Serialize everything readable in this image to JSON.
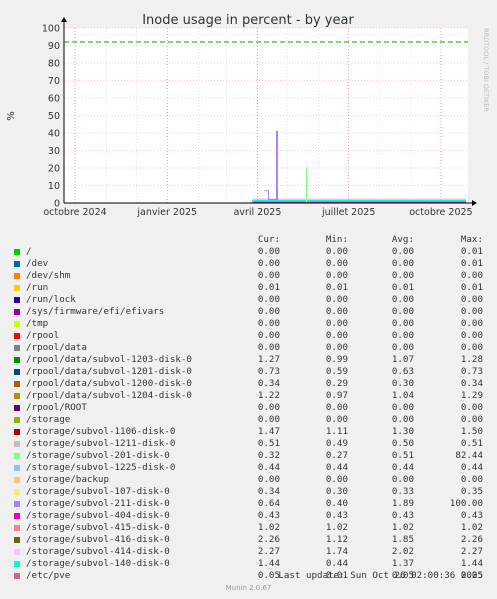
{
  "chart_data": {
    "type": "line",
    "title": "Inode usage in percent - by year",
    "ylabel": "%",
    "side_label": "RRDTOOL / TOBI OETIKER",
    "ylim": [
      0,
      100
    ],
    "yticks": [
      0,
      10,
      20,
      30,
      40,
      50,
      60,
      70,
      80,
      90,
      100
    ],
    "x_range": [
      "2024-09-20",
      "2025-10-28"
    ],
    "xticks": [
      {
        "date": "2024-10-01",
        "label": "octobre 2024"
      },
      {
        "date": "2025-01-01",
        "label": "janvier 2025"
      },
      {
        "date": "2025-04-01",
        "label": "avril 2025"
      },
      {
        "date": "2025-07-01",
        "label": "juillet 2025"
      },
      {
        "date": "2025-10-01",
        "label": "octobre 2025"
      }
    ],
    "warning_line": 92,
    "grid": true,
    "legend_headers": [
      "Cur:",
      "Min:",
      "Avg:",
      "Max:"
    ],
    "series": [
      {
        "name": "/",
        "color": "#00cc00",
        "cur": "0.00",
        "min": "0.00",
        "avg": "0.00",
        "max": "0.01"
      },
      {
        "name": "/dev",
        "color": "#0066b3",
        "cur": "0.00",
        "min": "0.00",
        "avg": "0.00",
        "max": "0.01"
      },
      {
        "name": "/dev/shm",
        "color": "#ff8000",
        "cur": "0.00",
        "min": "0.00",
        "avg": "0.00",
        "max": "0.00"
      },
      {
        "name": "/run",
        "color": "#ffcc00",
        "cur": "0.01",
        "min": "0.01",
        "avg": "0.01",
        "max": "0.01"
      },
      {
        "name": "/run/lock",
        "color": "#330099",
        "cur": "0.00",
        "min": "0.00",
        "avg": "0.00",
        "max": "0.00"
      },
      {
        "name": "/sys/firmware/efi/efivars",
        "color": "#990099",
        "cur": "0.00",
        "min": "0.00",
        "avg": "0.00",
        "max": "0.00"
      },
      {
        "name": "/tmp",
        "color": "#ccff00",
        "cur": "0.00",
        "min": "0.00",
        "avg": "0.00",
        "max": "0.00"
      },
      {
        "name": "/rpool",
        "color": "#ff0000",
        "cur": "0.00",
        "min": "0.00",
        "avg": "0.00",
        "max": "0.00"
      },
      {
        "name": "/rpool/data",
        "color": "#808080",
        "cur": "0.00",
        "min": "0.00",
        "avg": "0.00",
        "max": "0.00"
      },
      {
        "name": "/rpool/data/subvol-1203-disk-0",
        "color": "#008f00",
        "cur": "1.27",
        "min": "0.99",
        "avg": "1.07",
        "max": "1.28"
      },
      {
        "name": "/rpool/data/subvol-1201-disk-0",
        "color": "#00487d",
        "cur": "0.73",
        "min": "0.59",
        "avg": "0.63",
        "max": "0.73"
      },
      {
        "name": "/rpool/data/subvol-1200-disk-0",
        "color": "#b35a00",
        "cur": "0.34",
        "min": "0.29",
        "avg": "0.30",
        "max": "0.34"
      },
      {
        "name": "/rpool/data/subvol-1204-disk-0",
        "color": "#b38f00",
        "cur": "1.22",
        "min": "0.97",
        "avg": "1.04",
        "max": "1.29"
      },
      {
        "name": "/rpool/ROOT",
        "color": "#6b006b",
        "cur": "0.00",
        "min": "0.00",
        "avg": "0.00",
        "max": "0.00"
      },
      {
        "name": "/storage",
        "color": "#8fb300",
        "cur": "0.00",
        "min": "0.00",
        "avg": "0.00",
        "max": "0.00"
      },
      {
        "name": "/storage/subvol-1106-disk-0",
        "color": "#b30000",
        "cur": "1.47",
        "min": "1.11",
        "avg": "1.30",
        "max": "1.50"
      },
      {
        "name": "/storage/subvol-1211-disk-0",
        "color": "#bebebe",
        "cur": "0.51",
        "min": "0.49",
        "avg": "0.50",
        "max": "0.51"
      },
      {
        "name": "/storage/subvol-201-disk-0",
        "color": "#80ff80",
        "cur": "0.32",
        "min": "0.27",
        "avg": "0.51",
        "max": "82.44"
      },
      {
        "name": "/storage/subvol-1225-disk-0",
        "color": "#80c9ff",
        "cur": "0.44",
        "min": "0.44",
        "avg": "0.44",
        "max": "0.44"
      },
      {
        "name": "/storage/backup",
        "color": "#ffc080",
        "cur": "0.00",
        "min": "0.00",
        "avg": "0.00",
        "max": "0.00"
      },
      {
        "name": "/storage/subvol-107-disk-0",
        "color": "#ffe680",
        "cur": "0.34",
        "min": "0.30",
        "avg": "0.33",
        "max": "0.35"
      },
      {
        "name": "/storage/subvol-211-disk-0",
        "color": "#aa80ff",
        "cur": "0.64",
        "min": "0.40",
        "avg": "1.89",
        "max": "100.00"
      },
      {
        "name": "/storage/subvol-404-disk-0",
        "color": "#ee00cc",
        "cur": "0.43",
        "min": "0.43",
        "avg": "0.43",
        "max": "0.43"
      },
      {
        "name": "/storage/subvol-415-disk-0",
        "color": "#ff8080",
        "cur": "1.02",
        "min": "1.02",
        "avg": "1.02",
        "max": "1.02"
      },
      {
        "name": "/storage/subvol-416-disk-0",
        "color": "#666600",
        "cur": "2.26",
        "min": "1.12",
        "avg": "1.85",
        "max": "2.26"
      },
      {
        "name": "/storage/subvol-414-disk-0",
        "color": "#ffbfff",
        "cur": "2.27",
        "min": "1.74",
        "avg": "2.02",
        "max": "2.27"
      },
      {
        "name": "/storage/subvol-140-disk-0",
        "color": "#00ffcc",
        "cur": "1.44",
        "min": "0.44",
        "avg": "1.37",
        "max": "1.44"
      },
      {
        "name": "/etc/pve",
        "color": "#cc6699",
        "cur": "0.05",
        "min": "0.01",
        "avg": "0.05",
        "max": "0.05"
      }
    ]
  },
  "last_update": "Last update: Sun Oct 26 02:00:36 2025",
  "footer": "Munin 2.0.67"
}
